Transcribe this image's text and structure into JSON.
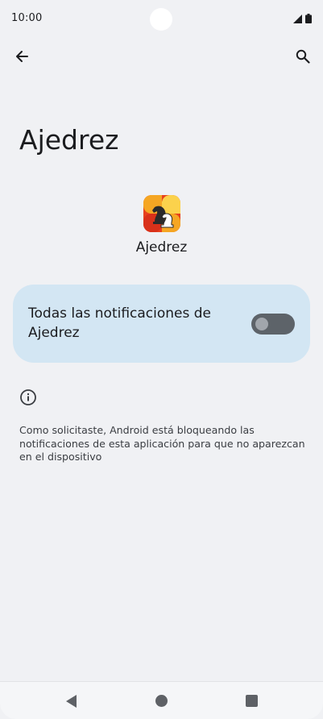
{
  "status_bar": {
    "time": "10:00",
    "icons": [
      "signal-icon",
      "battery-icon"
    ]
  },
  "app_bar": {
    "back_icon": "arrow-back-icon",
    "search_icon": "search-icon"
  },
  "page": {
    "title": "Ajedrez",
    "app_name": "Ajedrez",
    "app_icon": "chess-app-icon"
  },
  "notifications": {
    "label": "Todas las notificaciones de Ajedrez",
    "enabled": false
  },
  "info": {
    "icon": "info-icon",
    "text": "Como solicitaste, Android está bloqueando las notificaciones de esta aplicación para que no aparezcan en el dispositivo"
  },
  "nav_bar": {
    "icons": [
      "nav-back-icon",
      "nav-home-icon",
      "nav-recents-icon"
    ]
  },
  "colors": {
    "background": "#f0f1f4",
    "card": "#d3e6f3",
    "toggle_off_track": "#5d6369",
    "toggle_off_thumb": "#a1a6ac"
  }
}
